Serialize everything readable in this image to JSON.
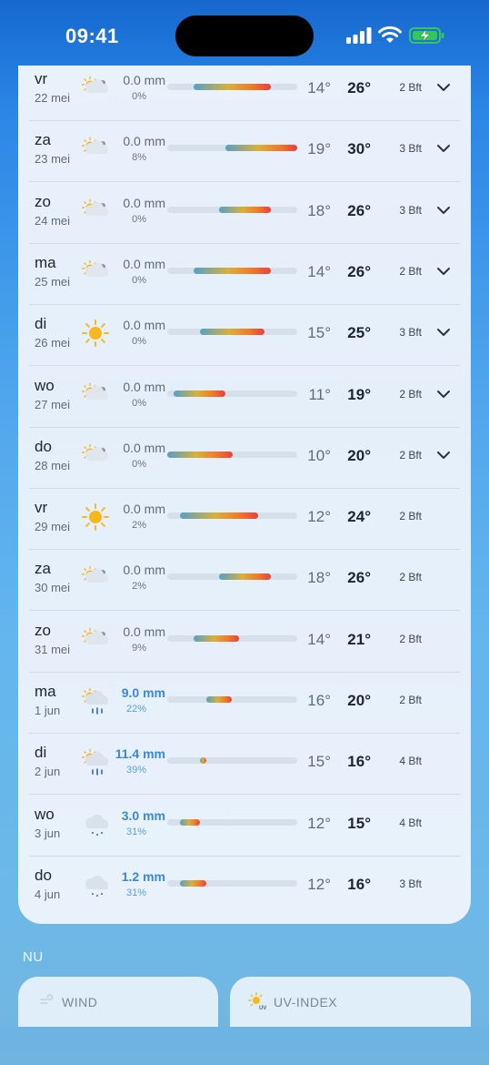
{
  "status_bar": {
    "time": "09:41"
  },
  "forecast": [
    {
      "day": "vr",
      "date": "22 mei",
      "icon": "partly-cloudy-icon",
      "precip": "0.0 mm",
      "chance": "0%",
      "wet": false,
      "tmin": "14°",
      "tmax": "26°",
      "wind": "2 Bft",
      "expandable": true,
      "range_min": 14,
      "range_max": 26
    },
    {
      "day": "za",
      "date": "23 mei",
      "icon": "partly-cloudy-icon",
      "precip": "0.0 mm",
      "chance": "8%",
      "wet": false,
      "tmin": "19°",
      "tmax": "30°",
      "wind": "3 Bft",
      "expandable": true,
      "range_min": 19,
      "range_max": 30
    },
    {
      "day": "zo",
      "date": "24 mei",
      "icon": "partly-cloudy-icon",
      "precip": "0.0 mm",
      "chance": "0%",
      "wet": false,
      "tmin": "18°",
      "tmax": "26°",
      "wind": "3 Bft",
      "expandable": true,
      "range_min": 18,
      "range_max": 26
    },
    {
      "day": "ma",
      "date": "25 mei",
      "icon": "partly-cloudy-icon",
      "precip": "0.0 mm",
      "chance": "0%",
      "wet": false,
      "tmin": "14°",
      "tmax": "26°",
      "wind": "2 Bft",
      "expandable": true,
      "range_min": 14,
      "range_max": 26
    },
    {
      "day": "di",
      "date": "26 mei",
      "icon": "sun-icon",
      "precip": "0.0 mm",
      "chance": "0%",
      "wet": false,
      "tmin": "15°",
      "tmax": "25°",
      "wind": "3 Bft",
      "expandable": true,
      "range_min": 15,
      "range_max": 25
    },
    {
      "day": "wo",
      "date": "27 mei",
      "icon": "partly-cloudy-icon",
      "precip": "0.0 mm",
      "chance": "0%",
      "wet": false,
      "tmin": "11°",
      "tmax": "19°",
      "wind": "2 Bft",
      "expandable": true,
      "range_min": 11,
      "range_max": 19
    },
    {
      "day": "do",
      "date": "28 mei",
      "icon": "partly-cloudy-icon",
      "precip": "0.0 mm",
      "chance": "0%",
      "wet": false,
      "tmin": "10°",
      "tmax": "20°",
      "wind": "2 Bft",
      "expandable": true,
      "range_min": 10,
      "range_max": 20
    },
    {
      "day": "vr",
      "date": "29 mei",
      "icon": "sun-icon",
      "precip": "0.0 mm",
      "chance": "2%",
      "wet": false,
      "tmin": "12°",
      "tmax": "24°",
      "wind": "2 Bft",
      "expandable": false,
      "range_min": 12,
      "range_max": 24
    },
    {
      "day": "za",
      "date": "30 mei",
      "icon": "partly-cloudy-icon",
      "precip": "0.0 mm",
      "chance": "2%",
      "wet": false,
      "tmin": "18°",
      "tmax": "26°",
      "wind": "2 Bft",
      "expandable": false,
      "range_min": 18,
      "range_max": 26
    },
    {
      "day": "zo",
      "date": "31 mei",
      "icon": "partly-cloudy-icon",
      "precip": "0.0 mm",
      "chance": "9%",
      "wet": false,
      "tmin": "14°",
      "tmax": "21°",
      "wind": "2 Bft",
      "expandable": false,
      "range_min": 14,
      "range_max": 21
    },
    {
      "day": "ma",
      "date": "1 jun",
      "icon": "sun-rain-icon",
      "precip": "9.0 mm",
      "chance": "22%",
      "wet": true,
      "tmin": "16°",
      "tmax": "20°",
      "wind": "2 Bft",
      "expandable": false,
      "range_min": 16,
      "range_max": 20
    },
    {
      "day": "di",
      "date": "2 jun",
      "icon": "sun-rain-icon",
      "precip": "11.4 mm",
      "chance": "39%",
      "wet": true,
      "tmin": "15°",
      "tmax": "16°",
      "wind": "4 Bft",
      "expandable": false,
      "range_min": 15,
      "range_max": 16
    },
    {
      "day": "wo",
      "date": "3 jun",
      "icon": "cloud-rain-icon",
      "precip": "3.0 mm",
      "chance": "31%",
      "wet": true,
      "tmin": "12°",
      "tmax": "15°",
      "wind": "4 Bft",
      "expandable": false,
      "range_min": 12,
      "range_max": 15
    },
    {
      "day": "do",
      "date": "4 jun",
      "icon": "cloud-rain-icon",
      "precip": "1.2 mm",
      "chance": "31%",
      "wet": true,
      "tmin": "12°",
      "tmax": "16°",
      "wind": "3 Bft",
      "expandable": false,
      "range_min": 12,
      "range_max": 16
    }
  ],
  "temp_scale": {
    "min": 10,
    "max": 30
  },
  "now_section": {
    "label": "NU"
  },
  "widgets": {
    "wind": {
      "title": "WIND",
      "icon": "wind-icon"
    },
    "uv": {
      "title": "UV-INDEX",
      "icon": "uv-sun-icon"
    }
  },
  "colors": {
    "accent_wet": "#3b87d8",
    "battery": "#34c759"
  }
}
